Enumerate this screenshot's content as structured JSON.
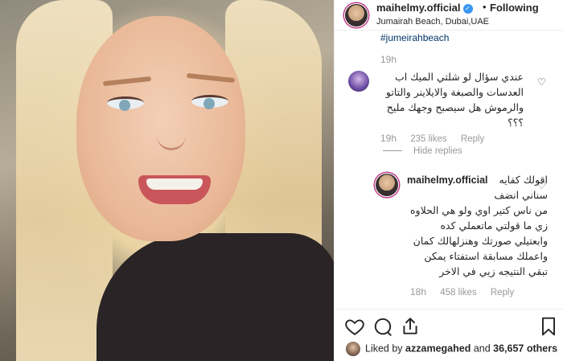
{
  "header": {
    "username": "maihelmy.official",
    "separator": "•",
    "follow_label": "Following",
    "location": "Jumairah Beach, Dubai,UAE"
  },
  "post": {
    "hashtag": "#jumeirahbeach",
    "time": "19h"
  },
  "comments": [
    {
      "text": "عندي سؤال لو شلتي الميك اب العدسات والصبغة والايلاينر والتاتو والرموش هل سيصبح وجهك مليح ؟؟؟",
      "time": "19h",
      "likes": "235 likes",
      "reply_label": "Reply",
      "hide_replies_label": "Hide replies"
    }
  ],
  "reply": {
    "username": "maihelmy.official",
    "text": "اقولك كفايه سناني انضف من ناس كتير اوي ولو هي الحلاوه زي ما قولتي ماتعملي كده وابعتيلي صورتك وهنزلهالك كمان واعملك مسابقة استفتاء يمكن تبقي النتيجه زيي في الاخر",
    "time": "18h",
    "likes": "458 likes",
    "reply_label": "Reply"
  },
  "likes_row": {
    "prefix": "Liked by",
    "user": "azzamegahed",
    "conjunction": "and",
    "count": "36,657 others"
  },
  "colors": {
    "link": "#003569",
    "muted": "#999999",
    "verified": "#3897f0"
  },
  "icons": [
    "heart-icon",
    "comment-icon",
    "share-icon",
    "bookmark-icon"
  ]
}
